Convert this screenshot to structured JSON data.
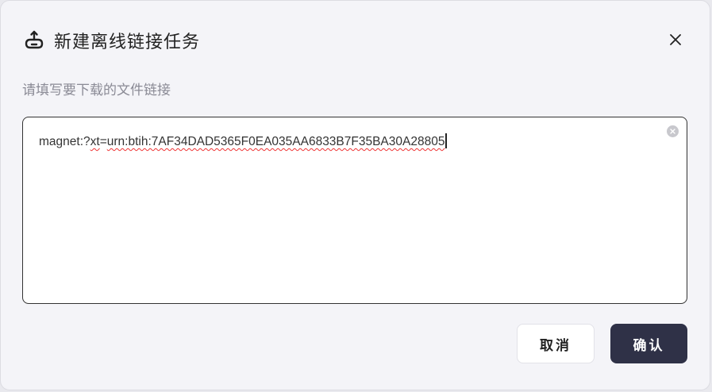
{
  "dialog": {
    "icon": "cloud-download-icon",
    "title": "新建离线链接任务",
    "close_icon": "close-icon",
    "hint": "请填写要下载的文件链接",
    "input": {
      "value_prefix": "magnet:?",
      "value_xt": "xt",
      "value_eq": "=",
      "value_rest": "urn:btih:7AF34DAD5365F0EA035AA6833B7F35BA30A28805",
      "clear_icon": "clear-icon"
    },
    "buttons": {
      "cancel": "取消",
      "confirm": "确认"
    },
    "colors": {
      "confirm_bg": "#2f3147",
      "background": "#f4f4f8"
    }
  }
}
